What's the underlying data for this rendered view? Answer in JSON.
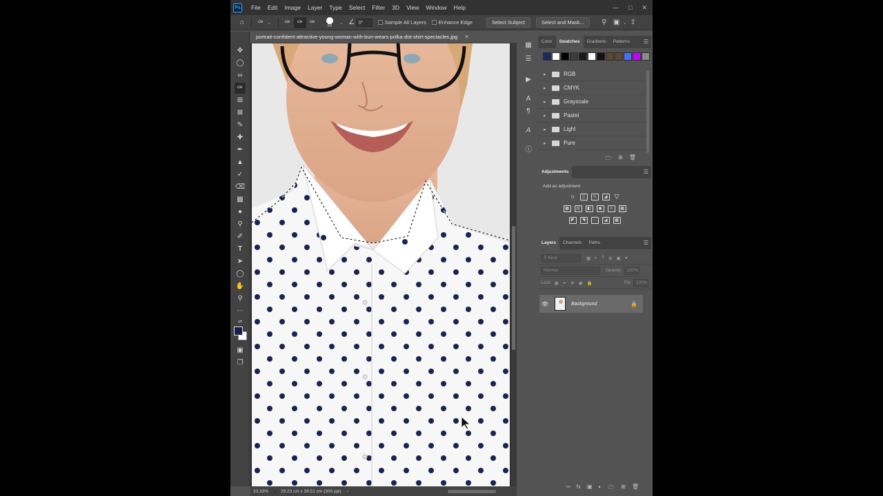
{
  "app": {
    "logo": "Ps",
    "menu": [
      "File",
      "Edit",
      "Image",
      "Layer",
      "Type",
      "Select",
      "Filter",
      "3D",
      "View",
      "Window",
      "Help"
    ]
  },
  "options": {
    "brush_size": "50",
    "angle": "0°",
    "sample_all_layers": "Sample All Layers",
    "enhance_edge": "Enhance Edge",
    "select_subject": "Select Subject",
    "select_and_mask": "Select and Mask..."
  },
  "document": {
    "tab_title": "portrait-confident-attractive-young-woman-with-bun-wears-polka-dot-shirt-spectacles.jpg",
    "zoom": "33.33%",
    "info": "29.23 cm x 39.51 cm (300 ppi)"
  },
  "colors": {
    "foreground": "#14224a",
    "background": "#ffffff"
  },
  "swatches_panel": {
    "tabs": [
      "Color",
      "Swatches",
      "Gradients",
      "Patterns"
    ],
    "active_tab": "Swatches",
    "recent": [
      "#1b2a5e",
      "#ffffff",
      "#000000",
      "#3c3c3c",
      "#1a1a1a",
      "#ffffff",
      "#111111",
      "#5a4636",
      "#5a4636",
      "#4a6cff",
      "#c400ff",
      "#8a8a8a"
    ],
    "folders": [
      "RGB",
      "CMYK",
      "Grayscale",
      "Pastel",
      "Light",
      "Pure"
    ]
  },
  "adjustments_panel": {
    "title": "Adjustments",
    "subtitle": "Add an adjustment"
  },
  "layers_panel": {
    "tabs": [
      "Layers",
      "Channels",
      "Paths"
    ],
    "active_tab": "Layers",
    "filter_placeholder": "Kind",
    "blend_mode": "Normal",
    "opacity_label": "Opacity:",
    "opacity": "100%",
    "lock_label": "Lock:",
    "fill_label": "Fill:",
    "fill": "100%",
    "layers": [
      {
        "name": "Background",
        "visible": true,
        "locked": true
      }
    ]
  }
}
